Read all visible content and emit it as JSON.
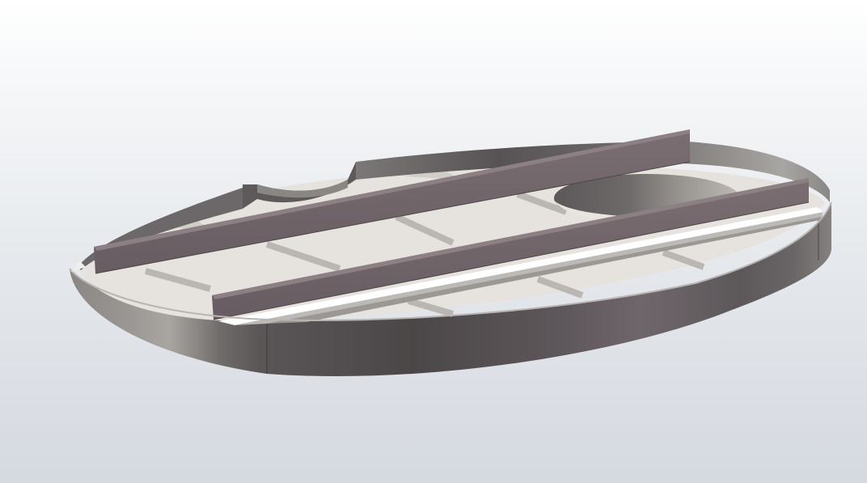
{
  "viewport": {
    "background_top": "#ffffff",
    "background_bottom": "#d5d9e0"
  },
  "model": {
    "shell_color": "#5a5658",
    "plate_color": "#e4e1dc",
    "beam_color": "#706468",
    "highlight_color": "#a9a6a4"
  }
}
